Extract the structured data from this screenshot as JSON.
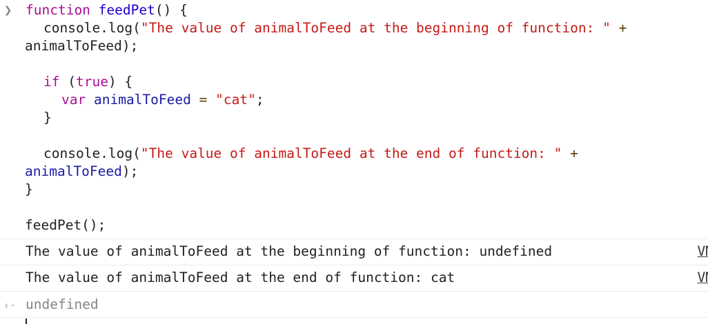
{
  "console": {
    "prompt_icon": "chevron-right-icon",
    "code": {
      "l1_kw": "function",
      "l1_fn": "feedPet",
      "l1_rest": "() {",
      "l2_pre": "console.log(",
      "l2_str": "\"The value of animalToFeed at the beginning of function: \"",
      "l2_op": "+",
      "l3_ident": "animalToFeed",
      "l3_rest": ");",
      "l5_kw": "if",
      "l5_open": "(",
      "l5_true": "true",
      "l5_close": ") {",
      "l6_kw": "var",
      "l6_ident": "animalToFeed",
      "l6_op": "=",
      "l6_str": "\"cat\"",
      "l6_semi": ";",
      "l7": "}",
      "l9_pre": "console.log(",
      "l9_str": "\"The value of animalToFeed at the end of function: \"",
      "l9_op": "+",
      "l10_ident": "animalToFeed",
      "l10_rest": ");",
      "l11": "}",
      "l13": "feedPet();"
    },
    "logs": [
      {
        "text": "The value of animalToFeed at the beginning of function: undefined",
        "link": "VM"
      },
      {
        "text": "The value of animalToFeed at the end of function: cat",
        "link": "VM"
      }
    ],
    "result_icon": "return-arrow-icon",
    "result": "undefined"
  }
}
